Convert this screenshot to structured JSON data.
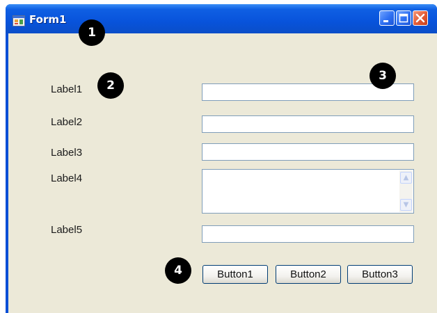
{
  "window": {
    "title": "Form1",
    "controls": {
      "minimize_icon": "minimize-icon",
      "maximize_icon": "maximize-icon",
      "close_icon": "close-icon"
    }
  },
  "form": {
    "labels": [
      "Label1",
      "Label2",
      "Label3",
      "Label4",
      "Label5"
    ],
    "textbox_values": [
      "",
      "",
      "",
      "",
      ""
    ],
    "buttons": [
      "Button1",
      "Button2",
      "Button3"
    ]
  },
  "badges": [
    "1",
    "2",
    "3",
    "4"
  ],
  "colors": {
    "titlebar": "#0853db",
    "client_background": "#ece9d8",
    "close_button": "#e25a34",
    "badge": "#000000"
  }
}
